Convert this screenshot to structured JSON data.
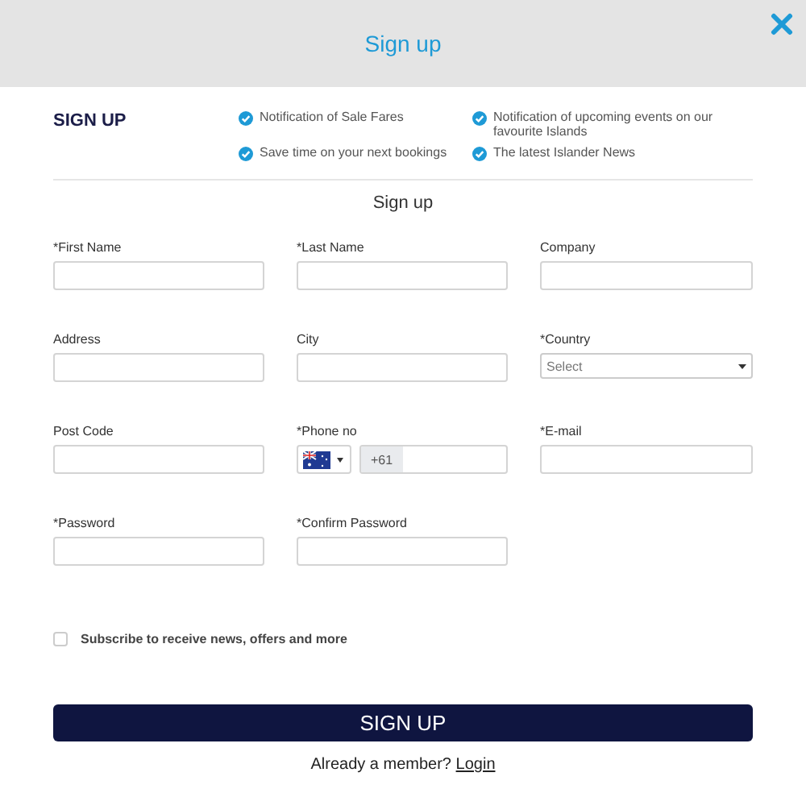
{
  "window": {
    "title": "Sign up"
  },
  "intro": {
    "heading": "SIGN UP",
    "benefits": [
      "Notification of Sale Fares",
      "Notification of upcoming events on our favourite Islands",
      "Save time on your next bookings",
      "The latest Islander News"
    ]
  },
  "form_title": "Sign up",
  "fields": [
    {
      "kind": "text",
      "label": "*First Name"
    },
    {
      "kind": "text",
      "label": "*Last Name"
    },
    {
      "kind": "text",
      "label": "Company"
    },
    {
      "kind": "text",
      "label": "Address"
    },
    {
      "kind": "text",
      "label": "City"
    },
    {
      "kind": "select",
      "label": "*Country",
      "placeholder": "Select"
    },
    {
      "kind": "text",
      "label": "Post Code"
    },
    {
      "kind": "phone",
      "label": "*Phone no",
      "prefix": "+61"
    },
    {
      "kind": "text",
      "label": "*E-mail"
    },
    {
      "kind": "text",
      "label": "*Password"
    },
    {
      "kind": "text",
      "label": "*Confirm Password"
    }
  ],
  "subscribe": {
    "label": "Subscribe to receive news, offers and more",
    "checked": false
  },
  "submit": "SIGN UP",
  "footer": {
    "text": "Already a member?",
    "link": "Login"
  }
}
